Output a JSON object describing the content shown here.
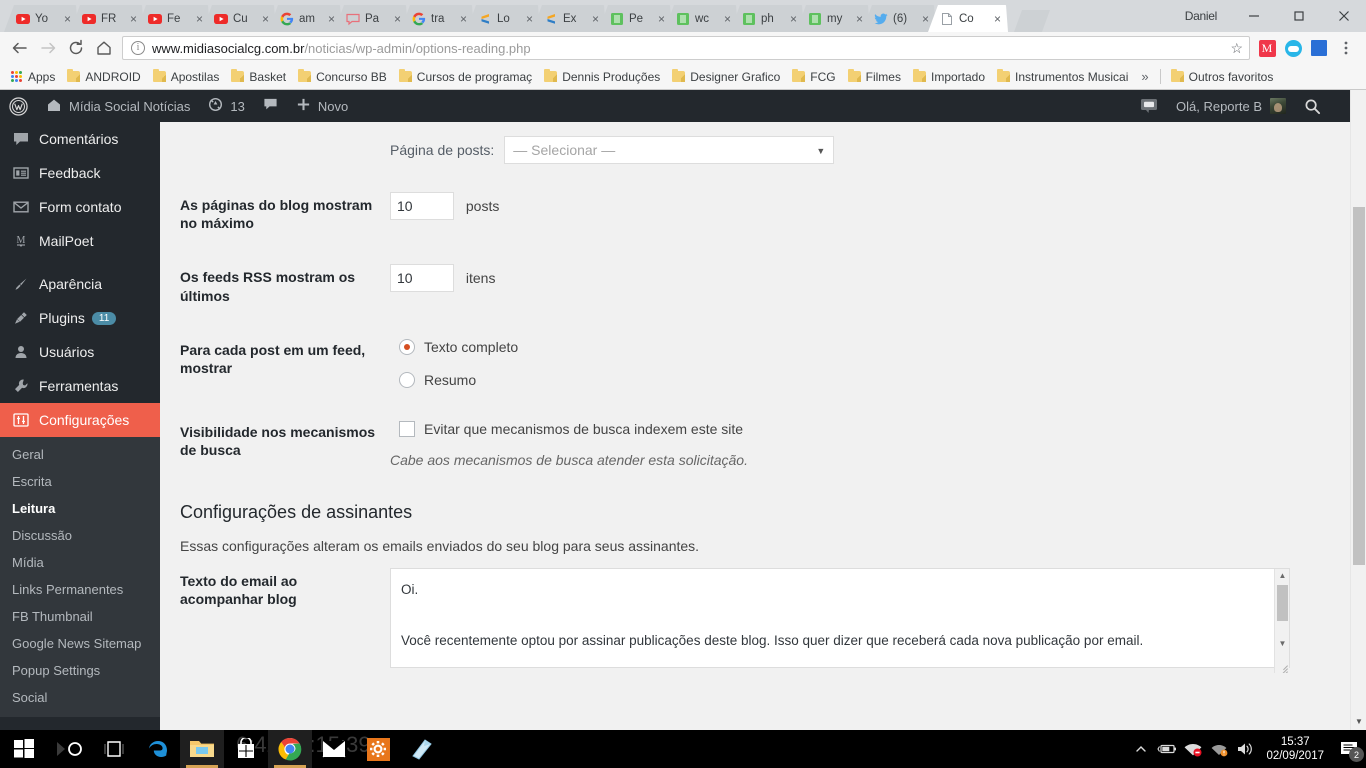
{
  "browser": {
    "tabs": [
      {
        "label": "Yo",
        "icon": "youtube-icon"
      },
      {
        "label": "FR",
        "icon": "youtube-icon"
      },
      {
        "label": "Fe",
        "icon": "youtube-icon"
      },
      {
        "label": "Cu",
        "icon": "youtube-icon"
      },
      {
        "label": "am",
        "icon": "google-icon"
      },
      {
        "label": "Pa",
        "icon": "chat-icon"
      },
      {
        "label": "tra",
        "icon": "google-icon"
      },
      {
        "label": "Lo",
        "icon": "sublime-icon"
      },
      {
        "label": "Ex",
        "icon": "sublime-icon"
      },
      {
        "label": "Pe",
        "icon": "xampp-icon"
      },
      {
        "label": "wc",
        "icon": "xampp-icon"
      },
      {
        "label": "ph",
        "icon": "xampp-icon"
      },
      {
        "label": "my",
        "icon": "xampp-icon"
      },
      {
        "label": "(6)",
        "icon": "twitter-icon"
      },
      {
        "label": "Co",
        "icon": "page-icon"
      }
    ],
    "active_tab_index": 14,
    "profile_name": "Daniel",
    "close_label": "×",
    "url_domain": "www.midiasocialcg.com.br",
    "url_path": "/noticias/wp-admin/options-reading.php",
    "bookmarks": [
      "Apps",
      "ANDROID",
      "Apostilas",
      "Basket",
      "Concurso BB",
      "Cursos de programaç",
      "Dennis Produções",
      "Designer Grafico",
      "FCG",
      "Filmes",
      "Importado",
      "Instrumentos Musicai"
    ],
    "bookmarks_overflow": "»",
    "other_bookmarks": "Outros favoritos"
  },
  "adminbar": {
    "wp_logo": "wordpress-icon",
    "site_name": "Mídia Social Notícias",
    "updates_count": "13",
    "comments_icon": "comment-icon",
    "new_label": "Novo",
    "greeting": "Olá, Reporte B",
    "search_icon": "search-icon"
  },
  "sidebar": {
    "items": [
      {
        "label": "Comentários",
        "icon": "comment-icon",
        "badge": ""
      },
      {
        "label": "Feedback",
        "icon": "feedback-icon",
        "badge": ""
      },
      {
        "label": "Form contato",
        "icon": "envelope-icon",
        "badge": ""
      },
      {
        "label": "MailPoet",
        "icon": "mailpoet-icon",
        "badge": ""
      },
      {
        "label": "Aparência",
        "icon": "brush-icon",
        "badge": ""
      },
      {
        "label": "Plugins",
        "icon": "plug-icon",
        "badge": "11"
      },
      {
        "label": "Usuários",
        "icon": "user-icon",
        "badge": ""
      },
      {
        "label": "Ferramentas",
        "icon": "wrench-icon",
        "badge": ""
      },
      {
        "label": "Configurações",
        "icon": "settings-icon",
        "badge": "",
        "current": true
      }
    ],
    "submenu": [
      {
        "label": "Geral"
      },
      {
        "label": "Escrita"
      },
      {
        "label": "Leitura",
        "current": true
      },
      {
        "label": "Discussão"
      },
      {
        "label": "Mídia"
      },
      {
        "label": "Links Permanentes"
      },
      {
        "label": "FB Thumbnail"
      },
      {
        "label": "Google News Sitemap"
      },
      {
        "label": "Popup Settings"
      },
      {
        "label": "Social"
      }
    ]
  },
  "main": {
    "posts_page": {
      "label": "Página de posts:",
      "value": "— Selecionar —"
    },
    "blog_pages": {
      "label": "As páginas do blog mostram no máximo",
      "value": "10",
      "unit": "posts"
    },
    "rss_feeds": {
      "label": "Os feeds RSS mostram os últimos",
      "value": "10",
      "unit": "itens"
    },
    "feed_post": {
      "label": "Para cada post em um feed, mostrar",
      "options": [
        "Texto completo",
        "Resumo"
      ],
      "selected": 0
    },
    "search_visibility": {
      "label": "Visibilidade nos mecanismos de busca",
      "checkbox_label": "Evitar que mecanismos de busca indexem este site",
      "checked": false,
      "description": "Cabe aos mecanismos de busca atender esta solicitação."
    },
    "subscribers": {
      "title": "Configurações de assinantes",
      "subtitle": "Essas configurações alteram os emails enviados do seu blog para seus assinantes.",
      "email_label": "Texto do email ao acompanhar blog",
      "email_value": "Oi.\n\nVocê recentemente optou por assinar publicações deste blog. Isso quer dizer que receberá cada nova publicação por email.\n\nPara ativar, clique em confirmar abaixo. Se você acredita que isto é um erro, ignore essa mensagem e nós nunca mais vamos"
    }
  },
  "taskbar": {
    "items": [
      {
        "name": "start-button",
        "icon": "windows-icon"
      },
      {
        "name": "cortana-button",
        "icon": "cortana-icon"
      },
      {
        "name": "task-view-button",
        "icon": "task-view-icon"
      },
      {
        "name": "edge-button",
        "icon": "edge-icon"
      },
      {
        "name": "file-explorer-button",
        "icon": "folder-icon"
      },
      {
        "name": "store-button",
        "icon": "store-icon"
      },
      {
        "name": "chrome-button",
        "icon": "chrome-icon"
      },
      {
        "name": "mail-button",
        "icon": "mail-icon"
      },
      {
        "name": "settings-app-button",
        "icon": "gear-icon"
      },
      {
        "name": "sticky-notes-button",
        "icon": "notes-icon"
      }
    ],
    "tray": {
      "show_hidden": "show-hidden-icons",
      "battery": "battery-icon",
      "network_error": "network-error-icon",
      "wifi": "wifi-icon",
      "volume": "volume-icon",
      "time": "15:37",
      "date": "02/09/2017",
      "notification_count": "2"
    }
  },
  "colors": {
    "wp_dark": "#23282d",
    "wp_submenu": "#32373c",
    "wp_accent": "#ef5f4b",
    "radio_accent": "#d54e21",
    "chrome_bg": "#d6d9dc"
  }
}
